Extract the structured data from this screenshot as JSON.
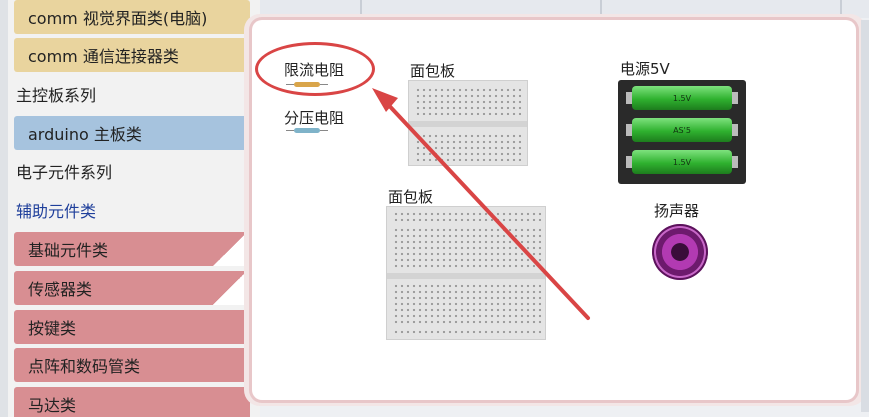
{
  "sidebar": {
    "items": [
      {
        "label": "comm 视觉界面类(电脑)"
      },
      {
        "label": "comm 通信连接器类"
      },
      {
        "label": "主控板系列"
      },
      {
        "label": "arduino 主板类"
      },
      {
        "label": "电子元件系列"
      },
      {
        "label": "辅助元件类"
      },
      {
        "label": "基础元件类"
      },
      {
        "label": "传感器类"
      },
      {
        "label": "按键类"
      },
      {
        "label": "点阵和数码管类"
      },
      {
        "label": "马达类"
      }
    ]
  },
  "canvas": {
    "components": {
      "current_limit_resistor": "限流电阻",
      "voltage_divider_resistor": "分压电阻",
      "breadboard_small": "面包板",
      "breadboard_large": "面包板",
      "power_5v": "电源5V",
      "speaker": "扬声器"
    },
    "battery_cells": [
      "1.5V",
      "AS'5",
      "1.5V"
    ]
  },
  "colors": {
    "annotation": "#d94545",
    "tan": "#e9d49e",
    "blue": "#a6c3de",
    "red": "#d88e92"
  }
}
